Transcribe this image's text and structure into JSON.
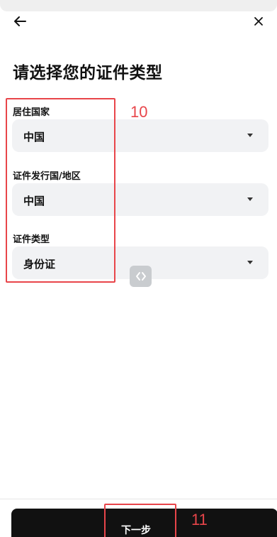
{
  "header": {
    "back_icon": "arrow-left-icon",
    "close_icon": "close-icon"
  },
  "page": {
    "title": "请选择您的证件类型"
  },
  "form": {
    "residence": {
      "label": "居住国家",
      "value": "中国"
    },
    "issuing_country": {
      "label": "证件发行国/地区",
      "value": "中国"
    },
    "document_type": {
      "label": "证件类型",
      "value": "身份证"
    }
  },
  "annotations": {
    "form_box_number": "10",
    "button_box_number": "11",
    "color": "#e8454a"
  },
  "footer": {
    "next_label": "下一步"
  },
  "colors": {
    "select_bg": "#f1f2f4",
    "button_bg": "#111111",
    "text": "#111111"
  }
}
